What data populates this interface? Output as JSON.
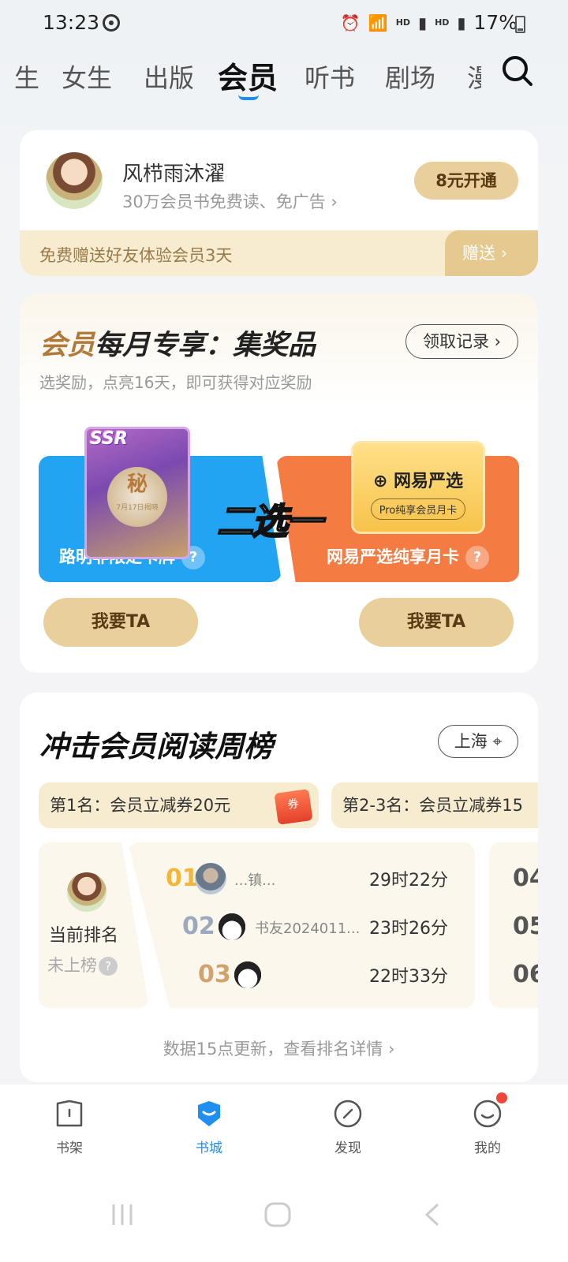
{
  "status_bar": {
    "time": "13:23",
    "network_1": "HD",
    "network_2": "HD",
    "battery": "17%"
  },
  "tabs": {
    "items": [
      {
        "label": "生"
      },
      {
        "label": "女生"
      },
      {
        "label": "出版"
      },
      {
        "label": "会员"
      },
      {
        "label": "听书"
      },
      {
        "label": "剧场"
      },
      {
        "label": "漫"
      }
    ],
    "active_index": 3,
    "accent_color": "#1f8ef1"
  },
  "member": {
    "name": "风栉雨沐濯",
    "subtitle": "30万会员书免费读、免广告",
    "open_label": "8元开通",
    "gift_text": "免费赠送好友体验会员3天",
    "gift_button": "赠送"
  },
  "monthly": {
    "title_accent": "会员",
    "title_rest": "每月专享：集奖品",
    "subtitle": "选奖励，点亮16天，即可获得对应奖励",
    "record_button": "领取记录",
    "or_text": "二选一",
    "options": [
      {
        "label": "路明非限定卡牌",
        "card_tag": "SSR",
        "card_title": "秘",
        "card_caption": "7月17日揭晓",
        "button": "我要TA",
        "color": "#22a4f2"
      },
      {
        "label": "网易严选纯享月卡",
        "card_brand": "网易严选",
        "card_pill": "Pro纯享会员月卡",
        "button": "我要TA",
        "color": "#f47c42"
      }
    ]
  },
  "ranking": {
    "title": "冲击会员阅读周榜",
    "location": "上海",
    "prizes": [
      {
        "text": "第1名：会员立减券20元"
      },
      {
        "text": "第2-3名：会员立减券15"
      }
    ],
    "coupon_label": "券",
    "current_label": "当前排名",
    "current_status": "未上榜",
    "rows": [
      {
        "rank": "01",
        "name": "...镇...",
        "time": "29时22分",
        "color": "#f2b73a"
      },
      {
        "rank": "02",
        "name": "书友2024011...",
        "time": "23时26分",
        "color": "#9aa9bf"
      },
      {
        "rank": "03",
        "name": "",
        "time": "22时33分",
        "color": "#d1a36c"
      }
    ],
    "more_ranks": [
      "04",
      "05",
      "06"
    ],
    "footer": "数据15点更新，查看排名详情"
  },
  "bottom_nav": {
    "items": [
      {
        "label": "书架",
        "icon": "bookshelf-icon"
      },
      {
        "label": "书城",
        "icon": "bookstore-icon"
      },
      {
        "label": "发现",
        "icon": "compass-icon"
      },
      {
        "label": "我的",
        "icon": "profile-icon"
      }
    ],
    "active_index": 1
  }
}
